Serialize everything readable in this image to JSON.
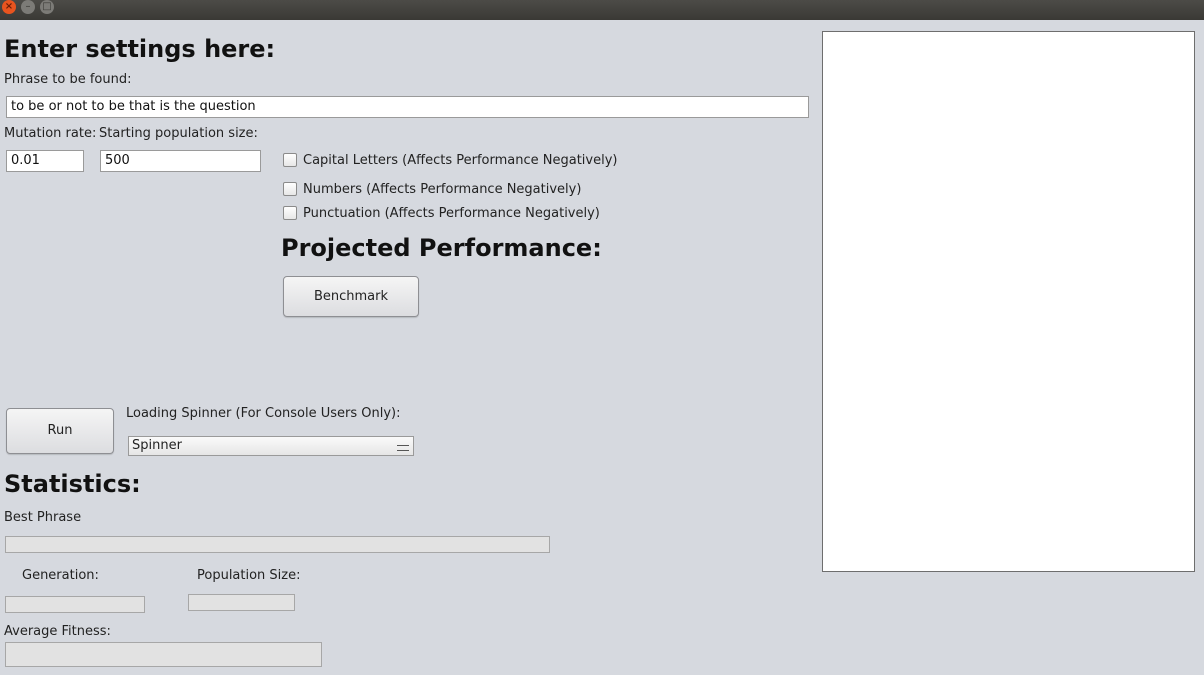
{
  "window": {
    "close_glyph": "×",
    "min_glyph": "–",
    "max_glyph": "□"
  },
  "settings": {
    "heading": "Enter settings here:",
    "phrase_label": "Phrase to be found:",
    "phrase_value": "to be or not to be that is the question",
    "mutation_label": "Mutation rate:",
    "mutation_value": "0.01",
    "population_label": "Starting population size:",
    "population_value": "500",
    "options": {
      "capital": "Capital Letters (Affects Performance Negatively)",
      "numbers": "Numbers (Affects Performance Negatively)",
      "punctuation": "Punctuation (Affects Performance Negatively)"
    }
  },
  "performance": {
    "heading": "Projected Performance:",
    "benchmark_label": "Benchmark"
  },
  "run": {
    "run_label": "Run",
    "spinner_label": "Loading Spinner (For Console Users Only):",
    "spinner_value": "Spinner"
  },
  "statistics": {
    "heading": "Statistics:",
    "best_phrase_label": "Best Phrase",
    "generation_label": "Generation:",
    "population_size_label": "Population Size:",
    "average_fitness_label": "Average Fitness:"
  }
}
